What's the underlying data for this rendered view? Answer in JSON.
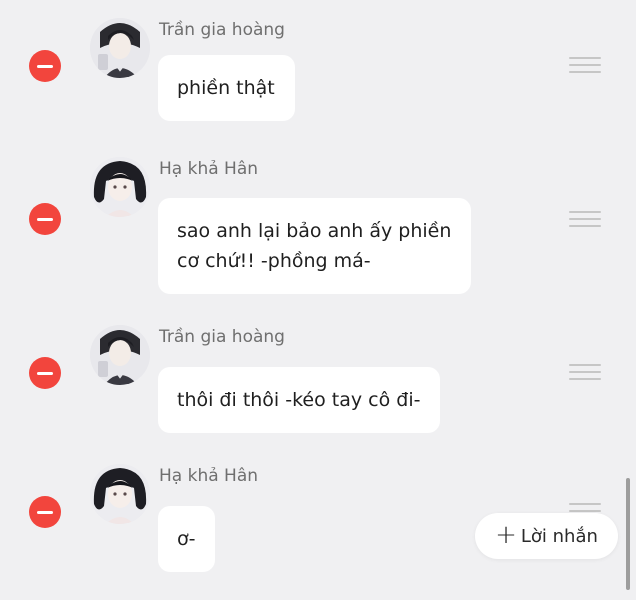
{
  "messages": [
    {
      "sender": "Trần gia hoàng",
      "text": "phiền thật",
      "avatar": "male-character-avatar"
    },
    {
      "sender": "Hạ khả Hân",
      "text": "sao anh lại bảo anh ấy phiền\ncơ chứ!! -phồng má-",
      "avatar": "female-character-avatar"
    },
    {
      "sender": "Trần gia hoàng",
      "text": "thôi đi thôi -kéo tay cô đi-",
      "avatar": "male-character-avatar"
    },
    {
      "sender": "Hạ khả Hân",
      "text": "ơ-",
      "avatar": "female-character-avatar"
    }
  ],
  "add_message": {
    "icon": "plus-icon",
    "label": "Lời nhắn"
  },
  "icons": {
    "remove": "remove-icon",
    "drag": "drag-handle-icon"
  },
  "colors": {
    "remove": "#f2453d",
    "background": "#f0f0f2",
    "bubble": "#ffffff"
  }
}
